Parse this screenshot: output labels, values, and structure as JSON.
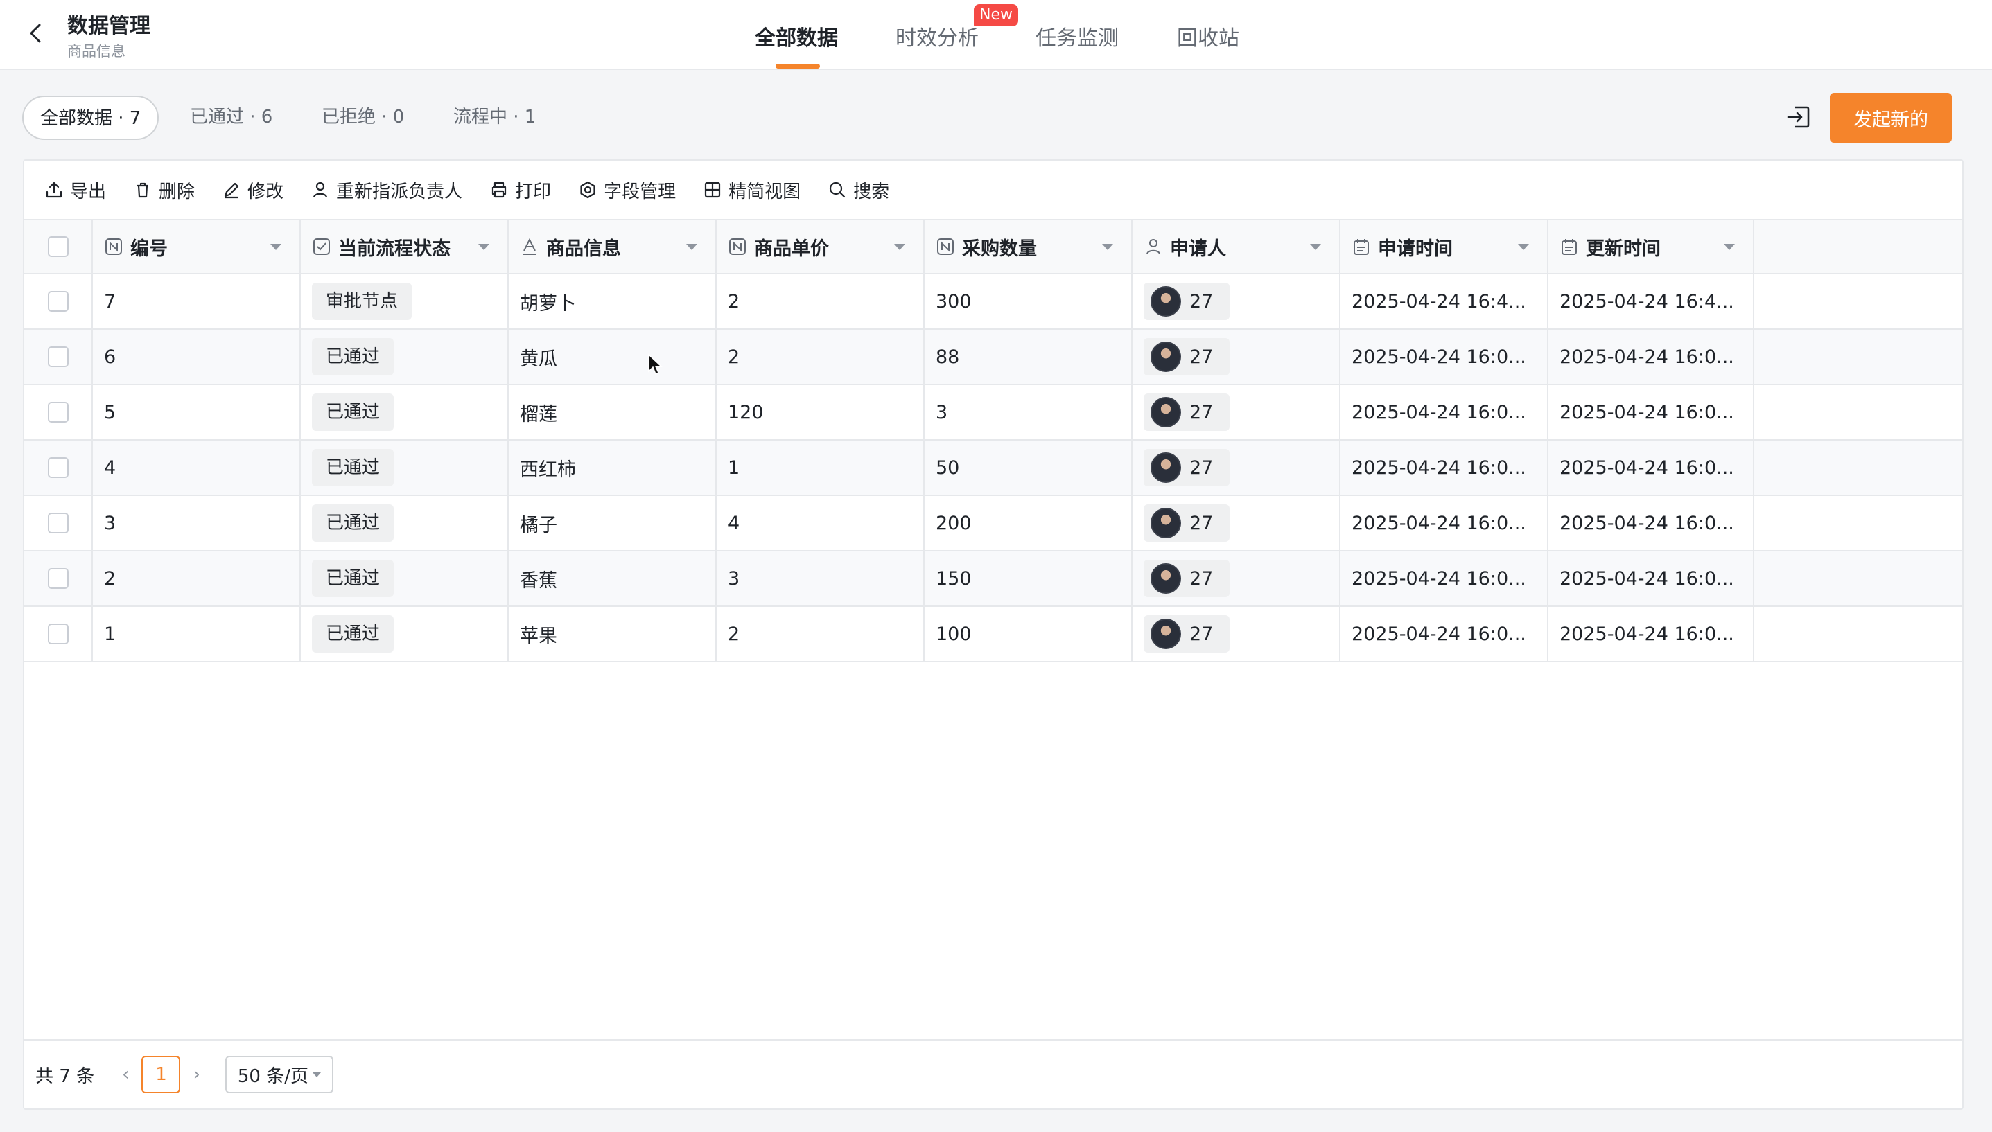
{
  "header": {
    "title": "数据管理",
    "subtitle": "商品信息",
    "tabs": [
      {
        "label": "全部数据",
        "active": true
      },
      {
        "label": "时效分析",
        "badge": "New"
      },
      {
        "label": "任务监测"
      },
      {
        "label": "回收站"
      }
    ]
  },
  "filters": [
    {
      "label": "全部数据 · 7",
      "active": true
    },
    {
      "label": "已通过 · 6"
    },
    {
      "label": "已拒绝 · 0"
    },
    {
      "label": "流程中 · 1"
    }
  ],
  "actions": {
    "primary_label": "发起新的",
    "exit_icon": "exit-icon"
  },
  "toolbar": {
    "export": "导出",
    "delete": "删除",
    "edit": "修改",
    "reassign": "重新指派负责人",
    "print": "打印",
    "fields": "字段管理",
    "compact": "精简视图",
    "search": "搜索"
  },
  "columns": [
    "编号",
    "当前流程状态",
    "商品信息",
    "商品单价",
    "采购数量",
    "申请人",
    "申请时间",
    "更新时间"
  ],
  "rows": [
    {
      "id": "7",
      "status": "审批节点",
      "product": "胡萝卜",
      "price": "2",
      "qty": "300",
      "applicant": "27",
      "applied": "2025-04-24 16:4...",
      "updated": "2025-04-24 16:4..."
    },
    {
      "id": "6",
      "status": "已通过",
      "product": "黄瓜",
      "price": "2",
      "qty": "88",
      "applicant": "27",
      "applied": "2025-04-24 16:0...",
      "updated": "2025-04-24 16:0..."
    },
    {
      "id": "5",
      "status": "已通过",
      "product": "榴莲",
      "price": "120",
      "qty": "3",
      "applicant": "27",
      "applied": "2025-04-24 16:0...",
      "updated": "2025-04-24 16:0..."
    },
    {
      "id": "4",
      "status": "已通过",
      "product": "西红柿",
      "price": "1",
      "qty": "50",
      "applicant": "27",
      "applied": "2025-04-24 16:0...",
      "updated": "2025-04-24 16:0..."
    },
    {
      "id": "3",
      "status": "已通过",
      "product": "橘子",
      "price": "4",
      "qty": "200",
      "applicant": "27",
      "applied": "2025-04-24 16:0...",
      "updated": "2025-04-24 16:0..."
    },
    {
      "id": "2",
      "status": "已通过",
      "product": "香蕉",
      "price": "3",
      "qty": "150",
      "applicant": "27",
      "applied": "2025-04-24 16:0...",
      "updated": "2025-04-24 16:0..."
    },
    {
      "id": "1",
      "status": "已通过",
      "product": "苹果",
      "price": "2",
      "qty": "100",
      "applicant": "27",
      "applied": "2025-04-24 16:0...",
      "updated": "2025-04-24 16:0..."
    }
  ],
  "pagination": {
    "total": "共 7 条",
    "page": "1",
    "page_size": "50 条/页"
  },
  "colors": {
    "accent": "#f5842b",
    "badge": "#f54a45"
  }
}
